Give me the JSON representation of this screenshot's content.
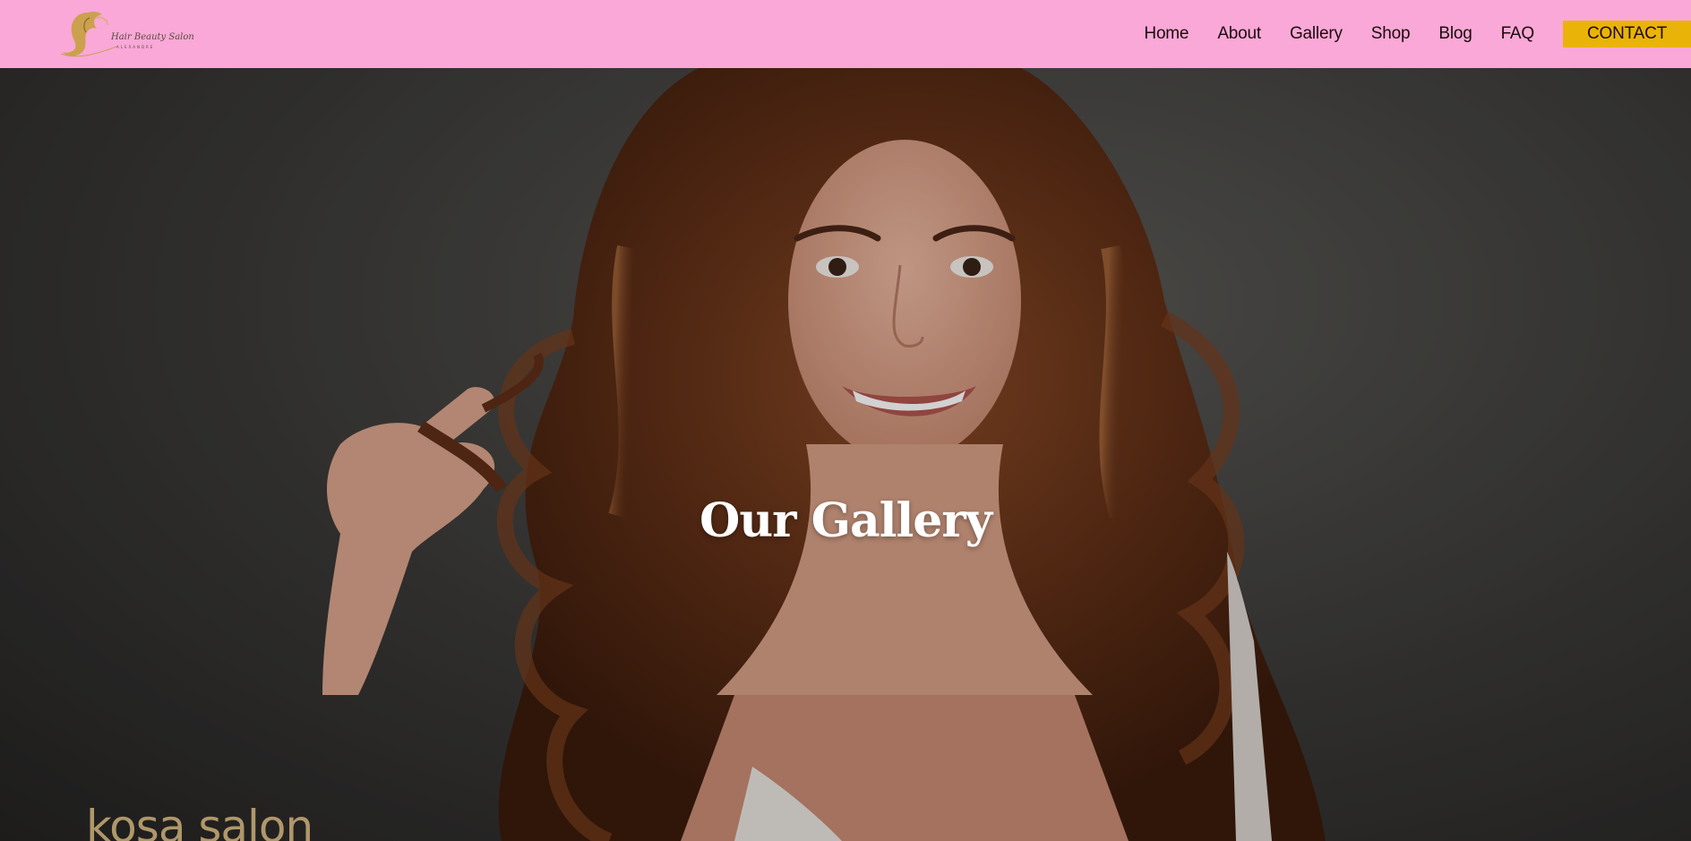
{
  "header": {
    "logo": {
      "name": "Hair Beauty Salon",
      "tagline": "ALEXANDRE",
      "gold": "#c8a046"
    },
    "background": "#f9a8d8",
    "nav": [
      {
        "label": "Home"
      },
      {
        "label": "About"
      },
      {
        "label": "Gallery"
      },
      {
        "label": "Shop"
      },
      {
        "label": "Blog"
      },
      {
        "label": "FAQ"
      }
    ],
    "contact_label": "CONTACT",
    "contact_color": "#eab308"
  },
  "hero": {
    "title": "Our Gallery",
    "watermark": "kosa salon",
    "image": "woman-with-long-wavy-brown-hair"
  }
}
